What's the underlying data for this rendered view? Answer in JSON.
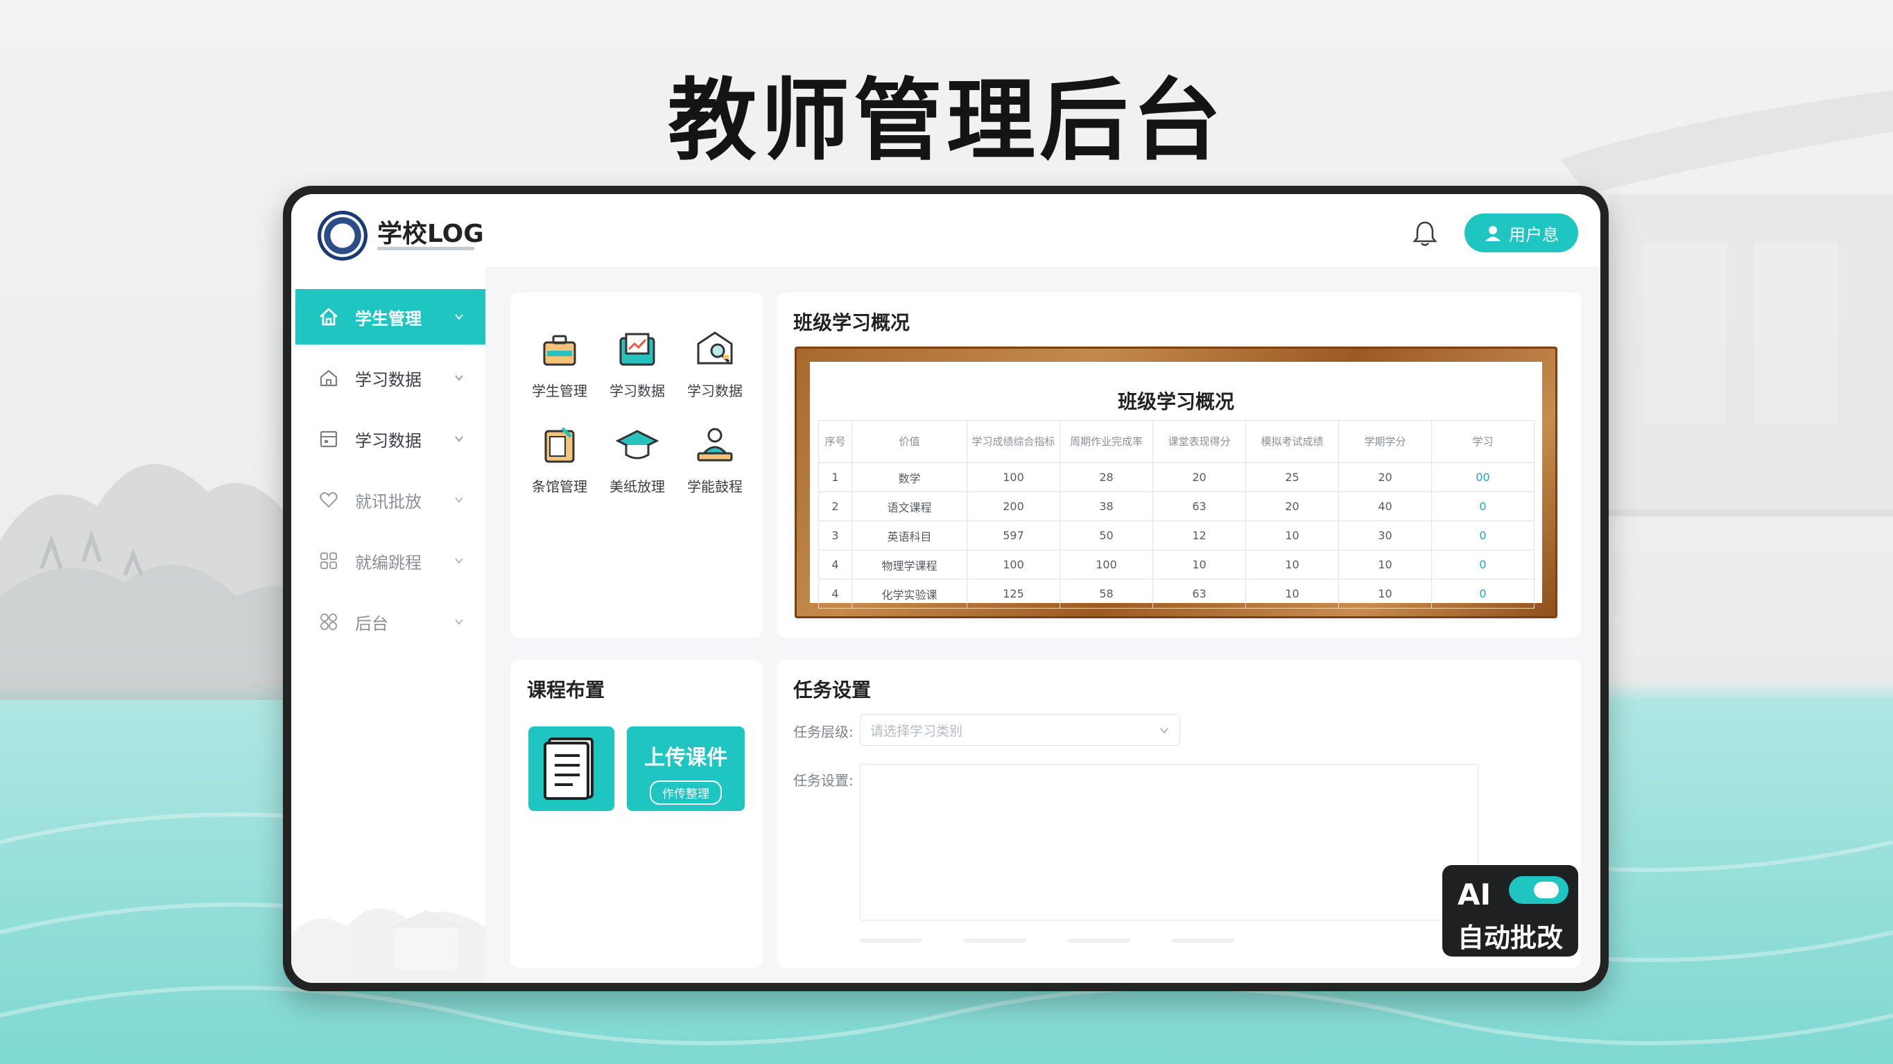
{
  "headline": "教师管理后台",
  "header": {
    "logo_title": "学校LOG",
    "user_button": "用户息",
    "accent_color": "#1fc5c1"
  },
  "sidebar": {
    "items": [
      {
        "label": "学生管理",
        "icon": "home-icon",
        "active": true
      },
      {
        "label": "学习数据",
        "icon": "home-outline-icon"
      },
      {
        "label": "学习数据",
        "icon": "calendar-icon"
      },
      {
        "label": "就讯批放",
        "icon": "heart-chat-icon"
      },
      {
        "label": "就编跳程",
        "icon": "grid-icon"
      },
      {
        "label": "后台",
        "icon": "apps-icon"
      }
    ]
  },
  "quick_access": {
    "items": [
      {
        "label": "学生管理",
        "icon": "briefcase-icon"
      },
      {
        "label": "学习数据",
        "icon": "chart-folder-icon"
      },
      {
        "label": "学习数据",
        "icon": "envelope-search-icon"
      },
      {
        "label": "条馆管理",
        "icon": "clipboard-icon"
      },
      {
        "label": "美纸放理",
        "icon": "graduation-cap-icon"
      },
      {
        "label": "学能鼓程",
        "icon": "person-desk-icon"
      }
    ]
  },
  "overview": {
    "card_title": "班级学习概况",
    "table_title": "班级学习概况",
    "columns": [
      "序号",
      "价值",
      "学习成绩综合指标",
      "周期作业完成率",
      "课堂表现得分",
      "模拟考试成绩",
      "学期学分",
      "学习"
    ],
    "rows": [
      [
        "1",
        "数学",
        "100",
        "28",
        "20",
        "25",
        "20",
        "00"
      ],
      [
        "2",
        "语文课程",
        "200",
        "38",
        "63",
        "20",
        "40",
        "0"
      ],
      [
        "3",
        "英语科目",
        "597",
        "50",
        "12",
        "10",
        "30",
        "0"
      ],
      [
        "4",
        "物理学课程",
        "100",
        "100",
        "10",
        "10",
        "10",
        "0"
      ],
      [
        "4",
        "化学实验课",
        "125",
        "58",
        "63",
        "10",
        "10",
        "0"
      ]
    ],
    "link_color": "#1aa7c8"
  },
  "course": {
    "card_title": "课程布置",
    "upload_label": "上传课件",
    "upload_sub": "作传整理"
  },
  "task": {
    "card_title": "任务设置",
    "category_label": "任务层级:",
    "category_placeholder": "请选择学习类别",
    "content_label": "任务设置:"
  },
  "ai_badge": {
    "ai_label": "AI",
    "caption": "自动批改",
    "toggle_on": true
  }
}
